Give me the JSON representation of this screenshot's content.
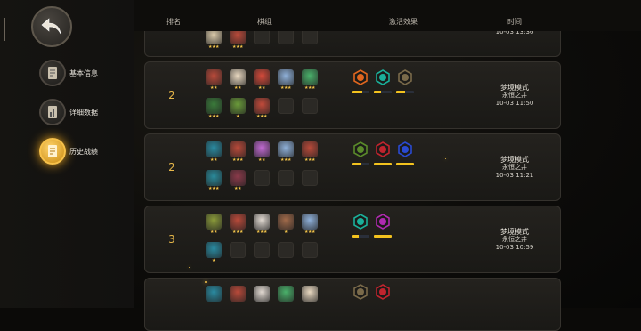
{
  "nav": {
    "back_label": "",
    "items": [
      {
        "label": "基本信息",
        "icon": "document-icon"
      },
      {
        "label": "详细数据",
        "icon": "chart-document-icon"
      },
      {
        "label": "历史战绩",
        "icon": "history-icon"
      }
    ],
    "active_index": 2
  },
  "table": {
    "headers": {
      "rank": "排名",
      "team": "棋组",
      "synergy": "激活效果",
      "time": "时间"
    }
  },
  "records": [
    {
      "rank": "",
      "units": [
        {
          "color": "#d8c8a8",
          "stars": "★★★"
        },
        {
          "color": "#b84a3a",
          "stars": "★★★"
        }
      ],
      "synergies": [],
      "mode": "",
      "place": "",
      "time": "10-03 13:36"
    },
    {
      "rank": "2",
      "units": [
        {
          "color": "#b84a3a",
          "stars": "★★"
        },
        {
          "color": "#e8d8c0",
          "stars": "★★"
        },
        {
          "color": "#d24a3a",
          "stars": "★★"
        },
        {
          "color": "#8fb0d8",
          "stars": "★★★"
        },
        {
          "color": "#4ab06a",
          "stars": "★★★"
        },
        {
          "color": "#3a7a3a",
          "stars": "★★★"
        },
        {
          "color": "#6a9a3a",
          "stars": "★"
        },
        {
          "color": "#c04a3a",
          "stars": "★★★"
        }
      ],
      "synergies": [
        {
          "icon": "flame-icon",
          "color": "#e0661e",
          "level": 0.6
        },
        {
          "icon": "paw-icon",
          "color": "#1ab09a",
          "level": 0.4
        },
        {
          "icon": "gear-icon",
          "color": "#7a6a4a",
          "level": 0.5
        }
      ],
      "mode": "梦境模式",
      "place": "永恒之井",
      "time": "10-03 11:50"
    },
    {
      "rank": "2",
      "units": [
        {
          "color": "#2a8aa0",
          "stars": "★★"
        },
        {
          "color": "#b84a3a",
          "stars": "★★★"
        },
        {
          "color": "#c06ad0",
          "stars": "★★"
        },
        {
          "color": "#8fb0d8",
          "stars": "★★★"
        },
        {
          "color": "#b84a3a",
          "stars": "★★★"
        },
        {
          "color": "#2a8a9a",
          "stars": "★★★"
        },
        {
          "color": "#8a3a4a",
          "stars": "★★"
        }
      ],
      "synergies": [
        {
          "icon": "orbs-icon",
          "color": "#5a8a2a",
          "level": 0.5
        },
        {
          "icon": "rune-icon",
          "color": "#c0242e",
          "level": 1.0
        },
        {
          "icon": "bolt-icon",
          "color": "#2a4ad0",
          "level": 1.0
        }
      ],
      "mode": "梦境模式",
      "place": "永恒之井",
      "time": "10-03 11:21"
    },
    {
      "rank": "3",
      "units": [
        {
          "color": "#8a9a3a",
          "stars": "★★"
        },
        {
          "color": "#b84a3a",
          "stars": "★★★"
        },
        {
          "color": "#e0d8d0",
          "stars": "★★★"
        },
        {
          "color": "#a06a4a",
          "stars": "★"
        },
        {
          "color": "#8fb0d8",
          "stars": "★★★"
        },
        {
          "color": "#2a8aa0",
          "stars": "★"
        }
      ],
      "synergies": [
        {
          "icon": "paw-icon",
          "color": "#1ab09a",
          "level": 0.4
        },
        {
          "icon": "demon-icon",
          "color": "#b02ab0",
          "level": 1.0
        }
      ],
      "mode": "梦境模式",
      "place": "永恒之井",
      "time": "10-03 10:59"
    },
    {
      "rank": "",
      "units": [
        {
          "color": "#2a8aa0",
          "stars": ""
        },
        {
          "color": "#b84a3a",
          "stars": ""
        },
        {
          "color": "#e0d8d0",
          "stars": ""
        },
        {
          "color": "#4ab06a",
          "stars": ""
        },
        {
          "color": "#e8d8c0",
          "stars": ""
        }
      ],
      "synergies": [
        {
          "icon": "gear-icon",
          "color": "#7a6a4a",
          "level": 0
        },
        {
          "icon": "rune-icon",
          "color": "#c0242e",
          "level": 0
        }
      ],
      "mode": "",
      "place": "",
      "time": ""
    }
  ]
}
